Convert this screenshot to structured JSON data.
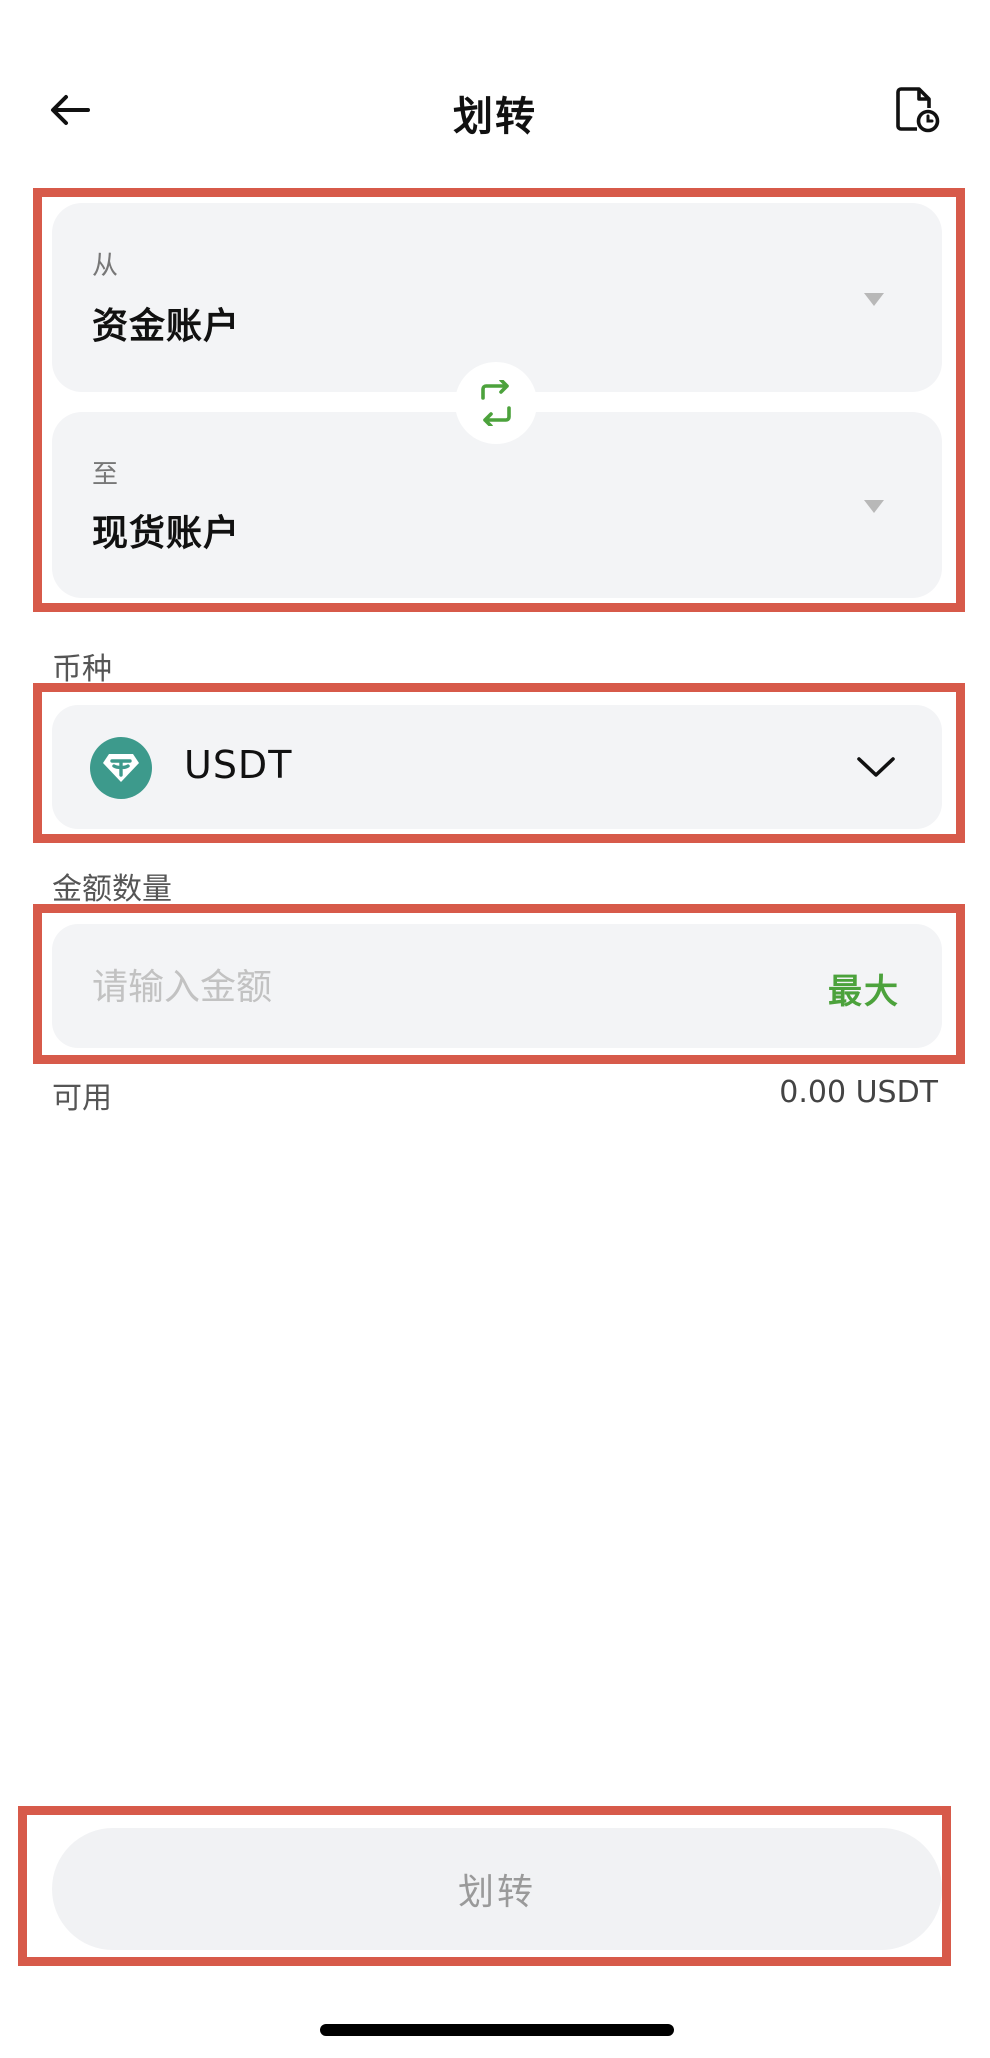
{
  "header": {
    "title": "划转",
    "back_icon": "arrow-left-icon",
    "history_icon": "document-clock-icon"
  },
  "transfer": {
    "from_label": "从",
    "from_account": "资金账户",
    "to_label": "至",
    "to_account": "现货账户",
    "swap_icon": "swap-arrows-icon"
  },
  "currency": {
    "section_label": "币种",
    "selected": "USDT",
    "coin_icon": "tether-icon",
    "chevron_icon": "chevron-down-icon"
  },
  "amount": {
    "section_label": "金额数量",
    "placeholder": "请输入金额",
    "value": "",
    "max_label": "最大",
    "available_label": "可用",
    "available_value": "0.00 USDT"
  },
  "submit": {
    "label": "划转"
  },
  "colors": {
    "accent_green": "#4ca23c",
    "coin_teal": "#3d9a8c",
    "annotation_red": "#d75a4a",
    "card_bg": "#f3f4f6"
  }
}
